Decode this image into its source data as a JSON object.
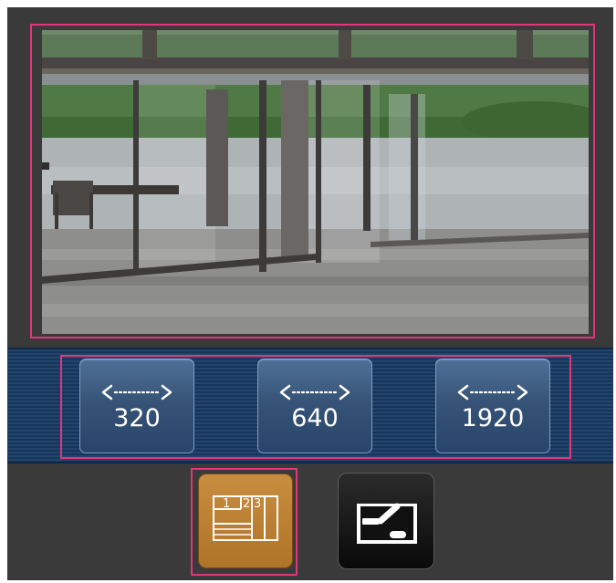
{
  "camera_view": {
    "content": "live camera image"
  },
  "resolution_buttons": [
    {
      "value": "320"
    },
    {
      "value": "640"
    },
    {
      "value": "1920"
    }
  ],
  "multi_screen_button": {
    "numbers": [
      "1",
      "2",
      "3"
    ]
  },
  "colors": {
    "highlight": "#e2367c",
    "panel_bg": "#3a3a3a",
    "band_blue": "#1f3f66",
    "selected_button": "#b97d30"
  }
}
